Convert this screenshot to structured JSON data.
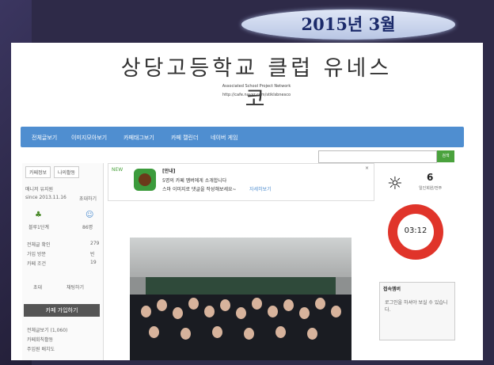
{
  "slide_title": "2015년  3월",
  "cafe": {
    "title": "상당고등학교 클럽 유네스코",
    "subtitle": "Associated School Project Network",
    "url": "http://cafe.naver.com/stiklsbnesco"
  },
  "menu": [
    "전체글보기",
    "이미지모아보기",
    "카페태그보기",
    "카페 캘린더",
    "네이버 게임"
  ],
  "search_button": "검색",
  "sidebar": {
    "tabs": [
      "카페정보",
      "나의활동"
    ],
    "manager": "매니저 유지원",
    "since": "since 2013.11.16",
    "invite": "초대하기",
    "level": "블루1단계",
    "members": "86명",
    "stats": [
      {
        "label": "전체글 확인",
        "value": "279"
      },
      {
        "label": "가입 방문",
        "value": "빈"
      },
      {
        "label": "카페 조건",
        "value": "19"
      }
    ],
    "actions": [
      "초대",
      "채팅하기"
    ],
    "join_button": "카페 가입하기",
    "links": [
      "전체글보기 (1,060)",
      "카페회칙활동",
      "주임원 배치도"
    ]
  },
  "notice": {
    "new_label": "NEW",
    "heading": "[안내]",
    "line1": "5명의 카페 멤버에게 소개합니다",
    "line2": "스마 이미지로 댓글을 작성해보세요~",
    "link": "자세히보기"
  },
  "weather": {
    "count": "6",
    "label": "일인회원/전주"
  },
  "clock": {
    "time": "03:12"
  },
  "login": {
    "heading": "접속멤버",
    "message": "로그인을 하셔야 보실 수 있습니다."
  },
  "icons": {
    "weather": "sun-icon",
    "join": "user-icon"
  }
}
